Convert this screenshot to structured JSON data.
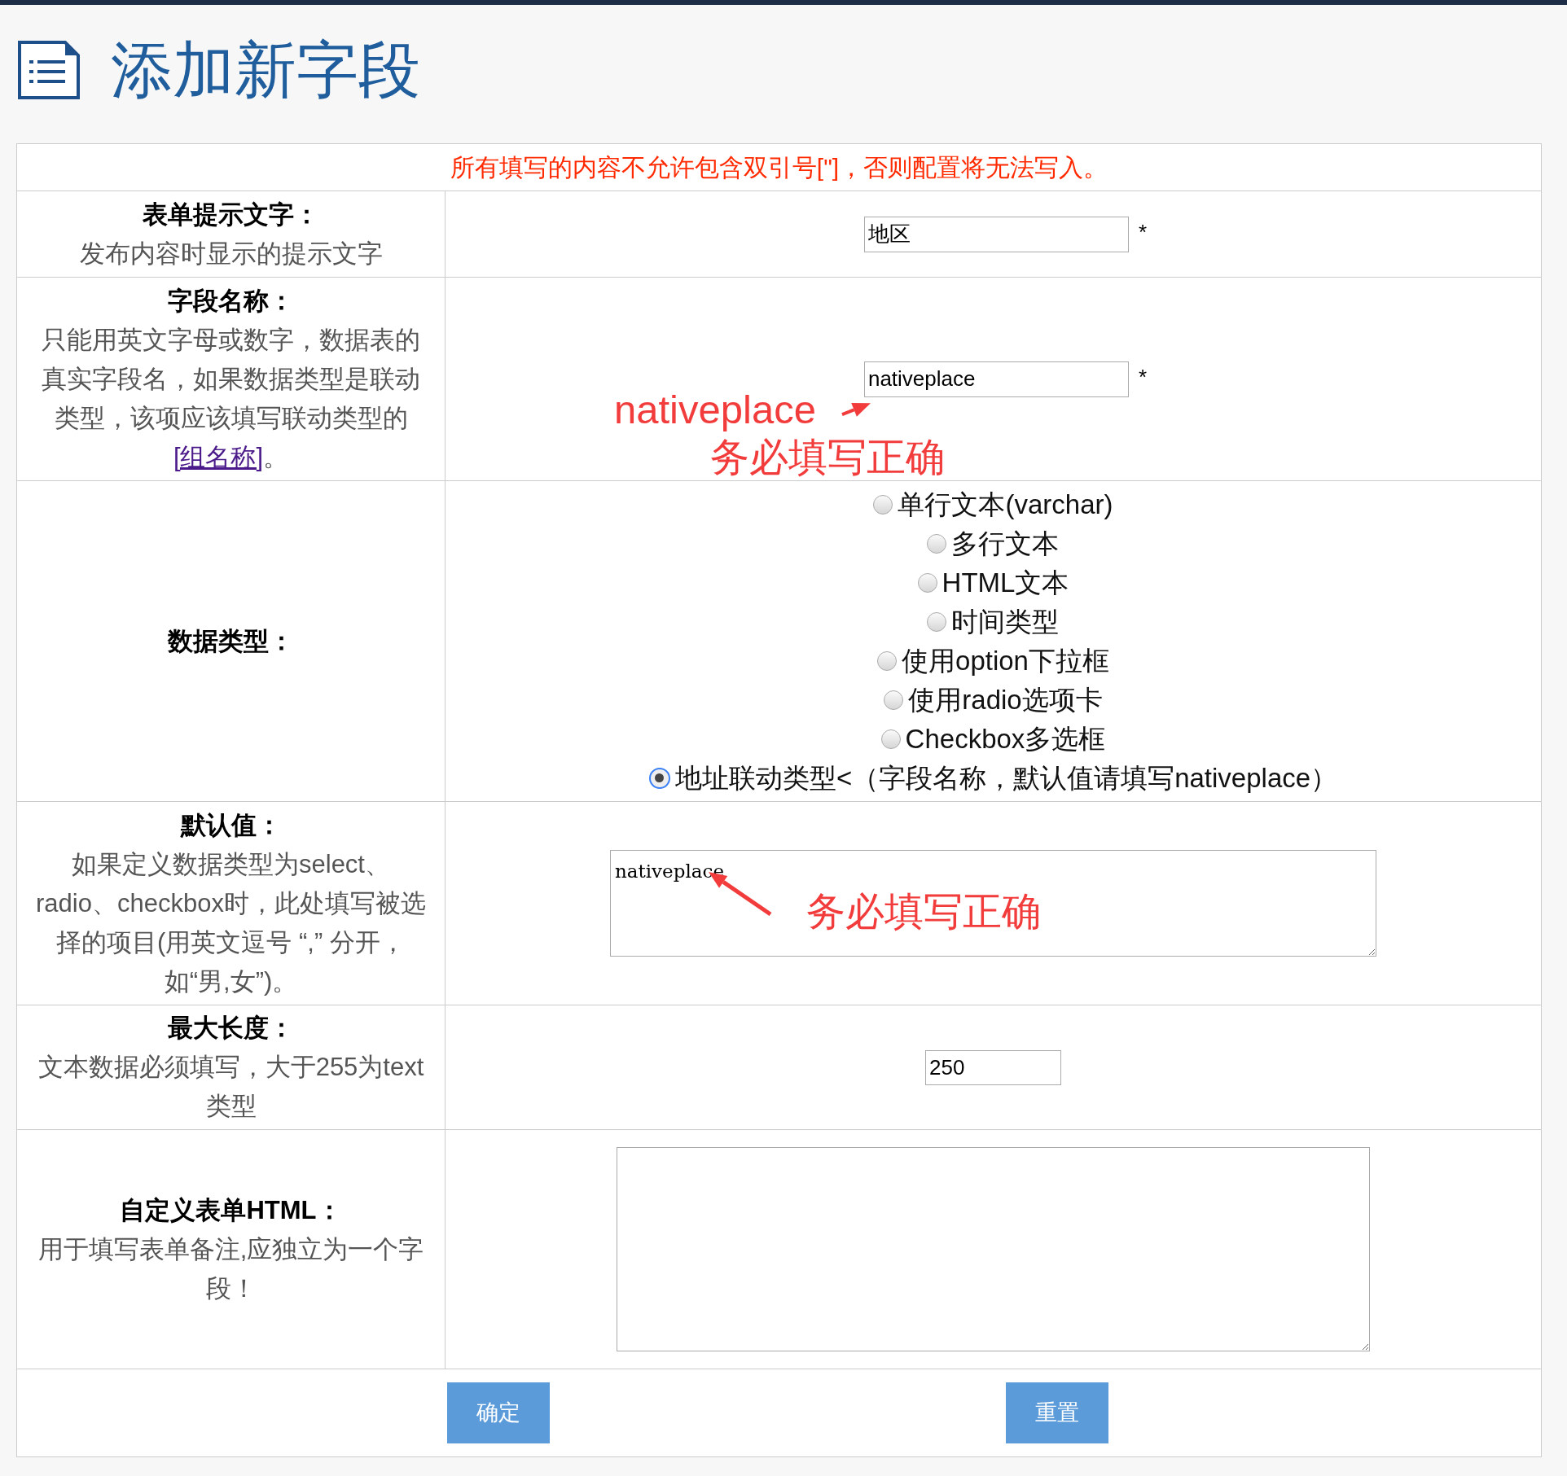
{
  "page": {
    "title": "添加新字段"
  },
  "notice": "所有填写的内容不允许包含双引号[\"]，否则配置将无法写入。",
  "rows": [
    {
      "kind": "text_input",
      "label": "表单提示文字：",
      "hint": "发布内容时显示的提示文字",
      "value": "地区",
      "required_mark": "*"
    },
    {
      "kind": "text_input",
      "label": "字段名称：",
      "hint": "只能用英文字母或数字，数据表的真实字段名，如果数据类型是联动类型，该项应该填写联动类型的",
      "link": "[组名称]",
      "hint_end": "。",
      "value": "nativeplace",
      "required_mark": "*",
      "annotations": [
        {
          "kind": "label",
          "text": "nativeplace"
        },
        {
          "kind": "note",
          "text": "务必填写正确"
        }
      ]
    },
    {
      "kind": "radio_group",
      "label": "数据类型：",
      "options": [
        {
          "label": "单行文本(varchar)",
          "selected": false
        },
        {
          "label": "多行文本",
          "selected": false
        },
        {
          "label": "HTML文本",
          "selected": false
        },
        {
          "label": "时间类型",
          "selected": false
        },
        {
          "label": "使用option下拉框",
          "selected": false
        },
        {
          "label": "使用radio选项卡",
          "selected": false
        },
        {
          "label": "Checkbox多选框",
          "selected": false
        },
        {
          "label": "地址联动类型<（字段名称，默认值请填写nativeplace）",
          "selected": true
        }
      ]
    },
    {
      "kind": "textarea",
      "label": "默认值：",
      "hint": "如果定义数据类型为select、radio、checkbox时，此处填写被选择的项目(用英文逗号 “,” 分开，如“男,女”)。",
      "value": "nativeplace",
      "annotations": [
        {
          "kind": "note",
          "text": "务必填写正确"
        }
      ]
    },
    {
      "kind": "short_input",
      "label": "最大长度：",
      "hint": "文本数据必须填写，大于255为text类型",
      "value": "250"
    },
    {
      "kind": "big_textarea",
      "label": "自定义表单HTML：",
      "hint": "用于填写表单备注,应独立为一个字段！"
    }
  ],
  "buttons": [
    "确定",
    "重置"
  ]
}
